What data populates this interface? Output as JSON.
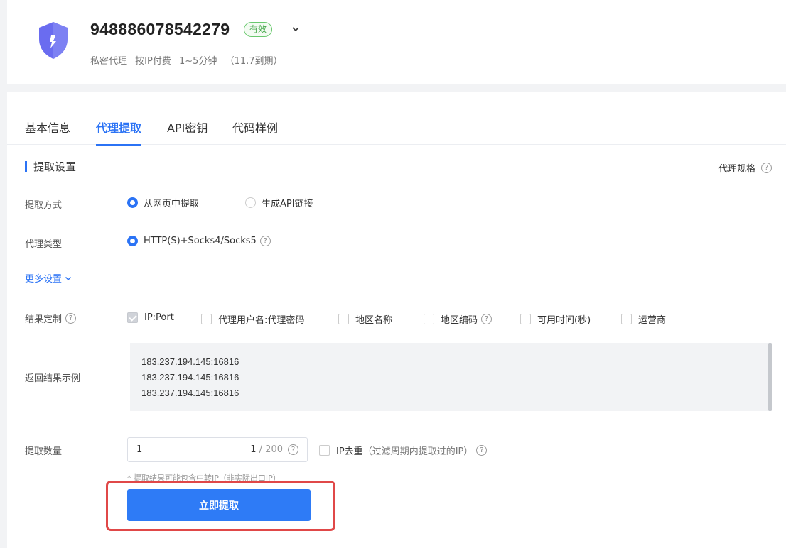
{
  "header": {
    "product_id": "948886078542279",
    "status_badge": "有效",
    "subtitle_parts": [
      "私密代理",
      "按IP付费",
      "1~5分钟",
      "（11.7到期）"
    ],
    "shield_color": "#6a6cf0"
  },
  "tabs": [
    {
      "label": "基本信息",
      "active": false
    },
    {
      "label": "代理提取",
      "active": true
    },
    {
      "label": "API密钥",
      "active": false
    },
    {
      "label": "代码样例",
      "active": false
    }
  ],
  "section": {
    "title": "提取设置",
    "spec_link": "代理规格"
  },
  "extract_method": {
    "label": "提取方式",
    "options": [
      {
        "label": "从网页中提取",
        "selected": true
      },
      {
        "label": "生成API链接",
        "selected": false
      }
    ]
  },
  "proxy_type": {
    "label": "代理类型",
    "option": "HTTP(S)+Socks4/Socks5"
  },
  "more_settings": "更多设置",
  "result_custom": {
    "label": "结果定制",
    "options": [
      {
        "label": "IP:Port",
        "checked": true
      },
      {
        "label": "代理用户名:代理密码",
        "checked": false
      },
      {
        "label": "地区名称",
        "checked": false
      },
      {
        "label": "地区编码",
        "checked": false
      },
      {
        "label": "可用时间(秒)",
        "checked": false
      },
      {
        "label": "运营商",
        "checked": false
      }
    ]
  },
  "sample": {
    "label": "返回结果示例",
    "lines": [
      "183.237.194.145:16816",
      "183.237.194.145:16816",
      "183.237.194.145:16816"
    ]
  },
  "quantity": {
    "label": "提取数量",
    "value": "1",
    "count": "1",
    "max": "200",
    "dedupe_label": "IP去重",
    "dedupe_note": "（过滤周期内提取过的IP）"
  },
  "hint": "* 提取结果可能包含中转IP（非实际出口IP）",
  "submit_label": "立即提取",
  "colors": {
    "accent": "#2b73f5",
    "badge_green": "#45a84b",
    "highlight_red": "#e04848"
  }
}
